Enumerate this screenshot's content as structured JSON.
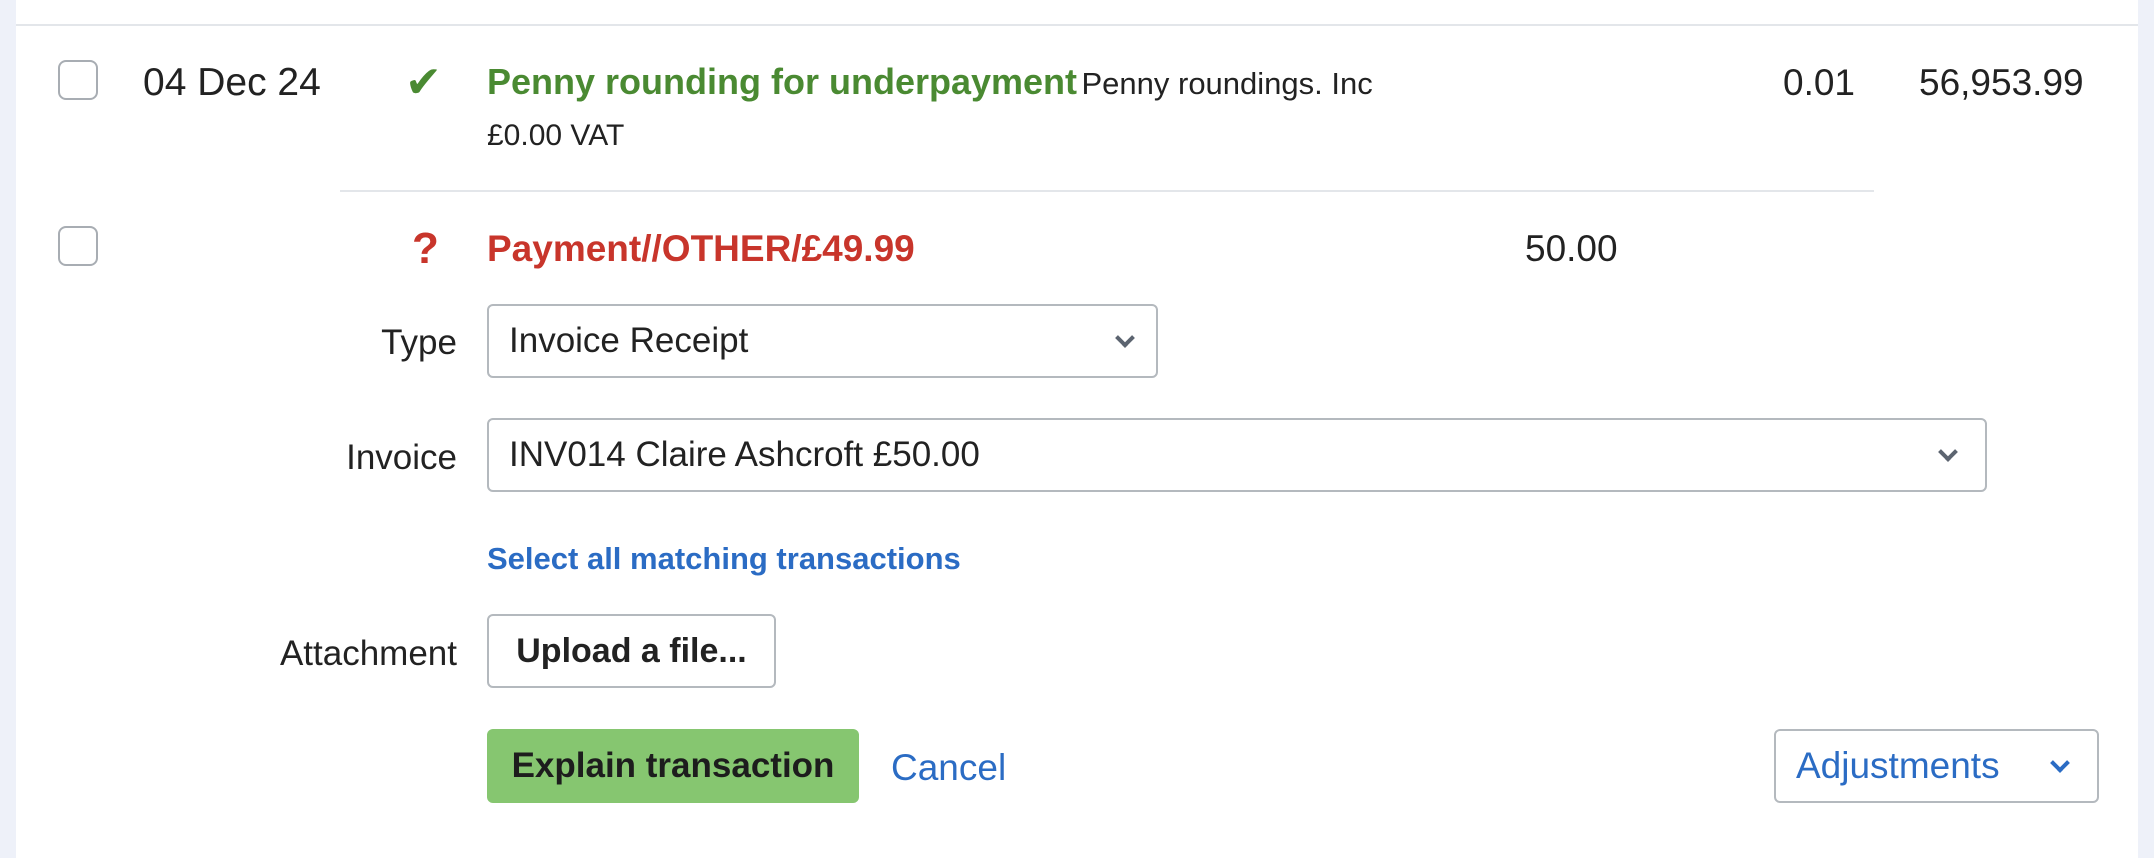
{
  "row1": {
    "date": "04 Dec 24",
    "status_glyph": "✔",
    "description": "Penny rounding for underpayment",
    "party": "Penny roundings. Inc",
    "vat": "£0.00 VAT",
    "amount": "0.01",
    "balance": "56,953.99"
  },
  "row2": {
    "status_glyph": "?",
    "description": "Payment//OTHER/£49.99",
    "amount": "50.00"
  },
  "form": {
    "type_label": "Type",
    "type_value": "Invoice Receipt",
    "invoice_label": "Invoice",
    "invoice_value": "INV014 Claire Ashcroft £50.00",
    "select_all_link": "Select all matching transactions",
    "attachment_label": "Attachment",
    "upload_label": "Upload a file...",
    "explain_label": "Explain transaction",
    "cancel_label": "Cancel",
    "adjustments_label": "Adjustments"
  },
  "colors": {
    "explained_green": "#4a8a32",
    "unexplained_red": "#c8352b",
    "link_blue": "#2b6cc4",
    "primary_button": "#86c670"
  }
}
